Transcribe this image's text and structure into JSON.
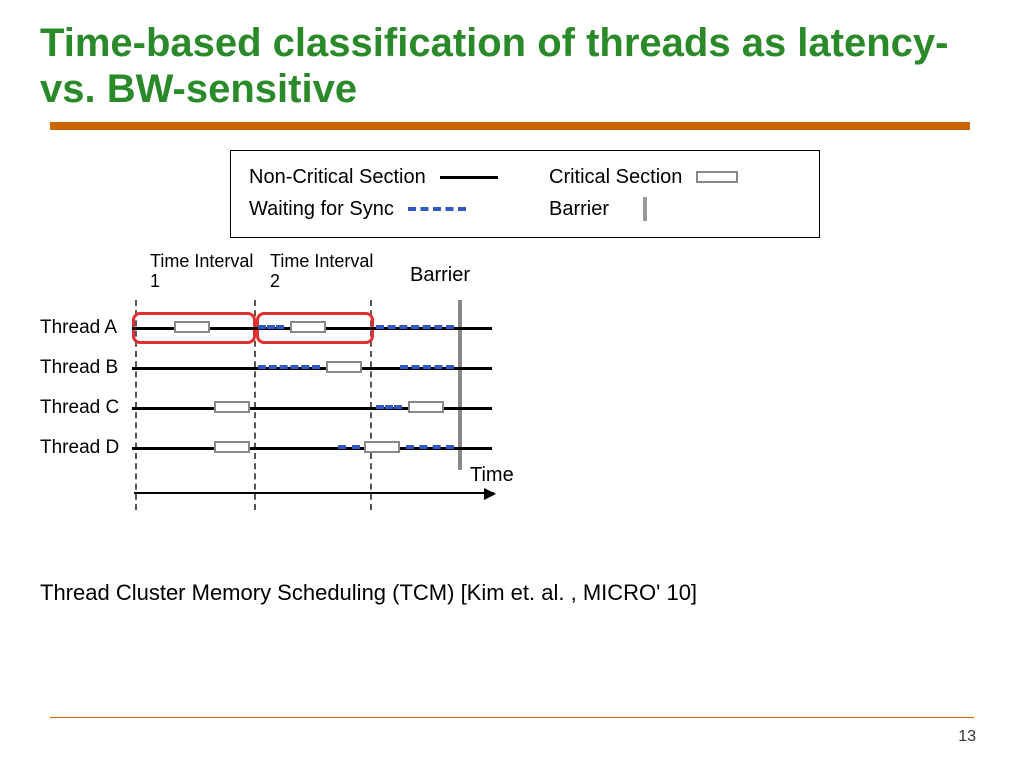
{
  "title": "Time-based classification of threads as latency- vs. BW-sensitive",
  "legend": {
    "nonCritical": "Non-Critical Section",
    "critical": "Critical Section",
    "waiting": "Waiting for Sync",
    "barrier": "Barrier"
  },
  "intervals": {
    "i1": "Time Interval 1",
    "i2": "Time Interval 2"
  },
  "barrierLabel": "Barrier",
  "threads": {
    "a": "Thread A",
    "b": "Thread B",
    "c": "Thread C",
    "d": "Thread D"
  },
  "timeLabel": "Time",
  "footnote": "Thread Cluster Memory Scheduling (TCM) [Kim et. al. , MICRO' 10]",
  "pageNumber": "13",
  "chart_data": {
    "type": "table",
    "title": "Thread execution timeline across two intervals before a barrier",
    "xlabel": "Time",
    "ylabel": "Thread",
    "categories": [
      "Thread A",
      "Thread B",
      "Thread C",
      "Thread D"
    ],
    "intervals": [
      "Time Interval 1",
      "Time Interval 2"
    ],
    "legend": [
      "Non-Critical Section",
      "Critical Section",
      "Waiting for Sync",
      "Barrier"
    ],
    "series": [
      {
        "name": "Thread A",
        "segments": [
          {
            "type": "non-critical",
            "start": 0,
            "end": 42
          },
          {
            "type": "critical",
            "start": 42,
            "end": 78
          },
          {
            "type": "non-critical",
            "start": 78,
            "end": 120
          },
          {
            "type": "waiting",
            "start": 120,
            "end": 152
          },
          {
            "type": "critical",
            "start": 152,
            "end": 188
          },
          {
            "type": "non-critical",
            "start": 188,
            "end": 235
          },
          {
            "type": "waiting",
            "start": 235,
            "end": 322
          }
        ]
      },
      {
        "name": "Thread B",
        "segments": [
          {
            "type": "non-critical",
            "start": 0,
            "end": 120
          },
          {
            "type": "waiting",
            "start": 120,
            "end": 188
          },
          {
            "type": "critical",
            "start": 188,
            "end": 224
          },
          {
            "type": "non-critical",
            "start": 224,
            "end": 262
          },
          {
            "type": "waiting",
            "start": 262,
            "end": 322
          }
        ]
      },
      {
        "name": "Thread C",
        "segments": [
          {
            "type": "non-critical",
            "start": 0,
            "end": 78
          },
          {
            "type": "critical",
            "start": 78,
            "end": 114
          },
          {
            "type": "non-critical",
            "start": 114,
            "end": 235
          },
          {
            "type": "waiting",
            "start": 235,
            "end": 268
          },
          {
            "type": "critical",
            "start": 268,
            "end": 304
          },
          {
            "type": "non-critical",
            "start": 304,
            "end": 322
          }
        ]
      },
      {
        "name": "Thread D",
        "segments": [
          {
            "type": "non-critical",
            "start": 0,
            "end": 78
          },
          {
            "type": "critical",
            "start": 78,
            "end": 114
          },
          {
            "type": "non-critical",
            "start": 114,
            "end": 200
          },
          {
            "type": "waiting",
            "start": 200,
            "end": 224
          },
          {
            "type": "critical",
            "start": 224,
            "end": 260
          },
          {
            "type": "waiting",
            "start": 260,
            "end": 322
          }
        ]
      }
    ],
    "barrier_at": 322,
    "highlight": {
      "thread": "Thread A",
      "intervals": [
        "Time Interval 1",
        "Time Interval 2"
      ]
    }
  }
}
